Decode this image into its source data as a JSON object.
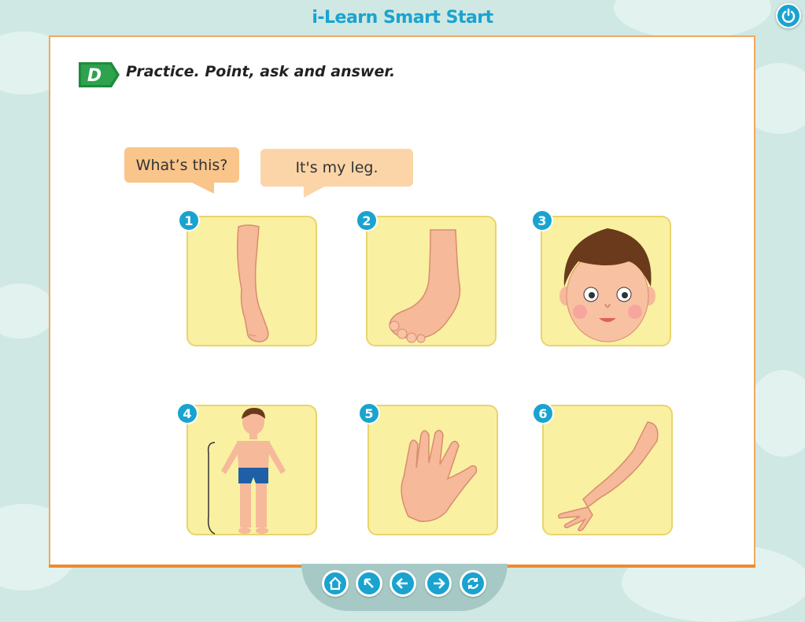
{
  "app": {
    "title": "i-Learn Smart Start"
  },
  "section": {
    "letter": "D",
    "instruction": "Practice. Point, ask and answer."
  },
  "dialogue": {
    "question": "What’s this?",
    "answer": "It's my leg."
  },
  "cards": [
    {
      "number": "1",
      "icon": "leg-icon"
    },
    {
      "number": "2",
      "icon": "foot-icon"
    },
    {
      "number": "3",
      "icon": "face-icon"
    },
    {
      "number": "4",
      "icon": "body-icon"
    },
    {
      "number": "5",
      "icon": "hand-icon"
    },
    {
      "number": "6",
      "icon": "arm-icon"
    }
  ],
  "nav": [
    "home-icon",
    "top-arrow-icon",
    "back-arrow-icon",
    "next-arrow-icon",
    "refresh-icon"
  ],
  "colors": {
    "accent": "#1aa3cf",
    "badge_green": "#1f8a3c",
    "card_fill": "#f9f0a2",
    "bubble": "#f9c58a",
    "panel_border": "#f0a860"
  }
}
